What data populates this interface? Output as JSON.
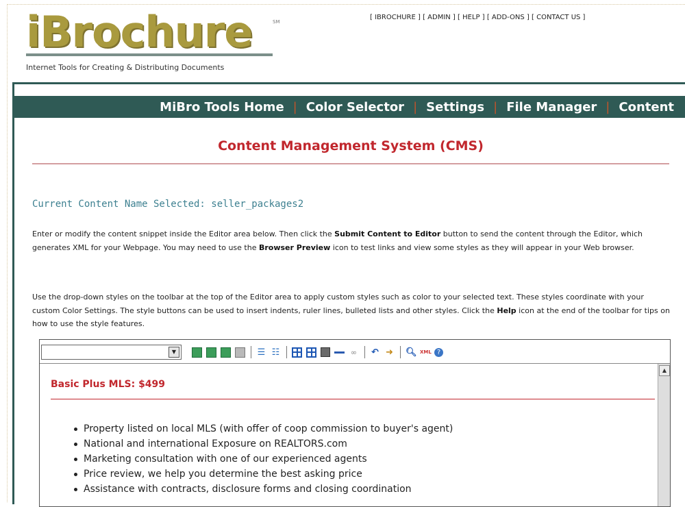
{
  "brand": {
    "logo_text": "iBrochure",
    "trademark": "SM",
    "tagline": "Internet Tools for Creating & Distributing Documents"
  },
  "top_links": [
    "[ IBROCHURE ]",
    "[ ADMIN ]",
    "[ HELP ]",
    "[ ADD-ONS ]",
    "[ CONTACT US ]"
  ],
  "nav": {
    "items": [
      "MiBro Tools Home",
      "Color Selector",
      "Settings",
      "File Manager",
      "Content"
    ],
    "separator": "|"
  },
  "page": {
    "title": "Content Management System (CMS)",
    "current_content_label": "Current Content Name Selected: seller_packages2",
    "para1_a": "Enter or modify the content snippet inside the Editor area below. Then click the ",
    "para1_b": "Submit Content to Editor",
    "para1_c": " button to send the content through the Editor, which generates XML for your Webpage. You may need to use the ",
    "para1_d": "Browser Preview",
    "para1_e": " icon to test links and view some styles as they will appear in your Web browser.",
    "para2_a": "Use the drop-down styles on the toolbar at the top of the Editor area to apply custom styles such as color to your selected text. These styles coordinate with your custom Color Settings. The style buttons can be used to insert indents, ruler lines, bulleted lists and other styles. Click the ",
    "para2_b": "Help",
    "para2_c": " icon at the end of the toolbar for tips on how to use the style features."
  },
  "editor": {
    "style_select_value": "",
    "toolbar_icons": [
      "align-left-icon",
      "align-center-icon",
      "align-right-icon",
      "indent-icon",
      "ordered-list-icon",
      "bulleted-list-icon",
      "table-icon",
      "table-grid-icon",
      "image-icon",
      "horizontal-rule-icon",
      "link-icon",
      "undo-icon",
      "redo-icon",
      "browser-preview-icon",
      "xml-icon",
      "help-icon"
    ],
    "xml_label": "XML",
    "content": {
      "heading": "Basic Plus MLS: $499",
      "items": [
        "Property listed on local MLS (with offer of coop commission to buyer's agent)",
        "National and international Exposure on REALTORS.com",
        "Marketing consultation with one of our experienced agents",
        "Price review, we help you determine the best asking price",
        "Assistance with contracts, disclosure forms and closing coordination"
      ]
    }
  },
  "colors": {
    "nav_bg": "#2f5a55",
    "title_red": "#c1272d",
    "label_teal": "#3d8090",
    "logo_gold": "#a99a3e"
  }
}
